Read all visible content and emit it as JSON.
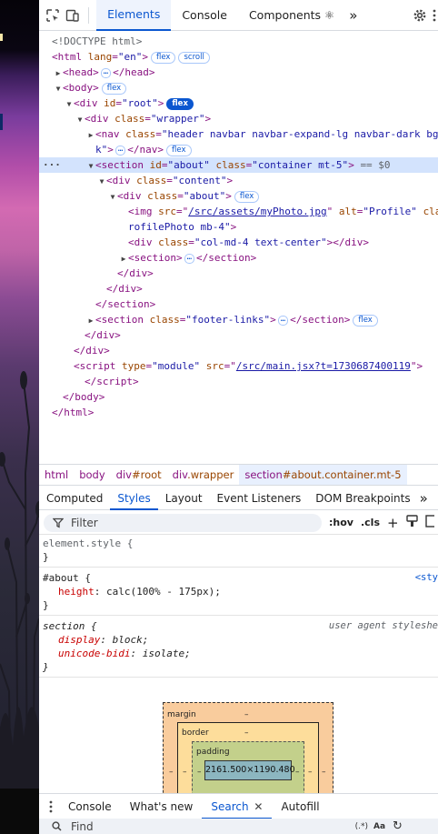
{
  "toolbar": {
    "tabs": [
      "Elements",
      "Console",
      "Components ⚛"
    ],
    "active": "Elements",
    "more": "»"
  },
  "dom": {
    "doctype": "<!DOCTYPE html>",
    "html_tag": "html",
    "html_attr": "lang",
    "html_val": "\"en\"",
    "badge_flex": "flex",
    "badge_scroll": "scroll",
    "head": "head",
    "body": "body",
    "div": "div",
    "id_attr": "id",
    "root_val": "\"root\"",
    "class_attr": "class",
    "wrapper_val": "\"wrapper\"",
    "nav": "nav",
    "nav_class_1": "\"header navbar navbar-expand-lg navbar-dark bg",
    "nav_class_2": "k\"",
    "section": "section",
    "about_id": "\"about\"",
    "section_class": "\"container mt-5\"",
    "eq_var": "== $0",
    "content_val": "\"content\"",
    "about_val": "\"about\"",
    "img": "img",
    "src_attr": "src",
    "img_src": "/src/assets/myPhoto.jpg",
    "alt_attr": "alt",
    "alt_val": "\"Profile\"",
    "img_cont": "cla",
    "img_class_2": "rofilePhoto mb-4\"",
    "col_val": "\"col-md-4 text-center\"",
    "footer_val": "\"footer-links\"",
    "script": "script",
    "type_attr": "type",
    "module_val": "\"module\"",
    "script_src": "/src/main.jsx?t=1730687400119"
  },
  "breadcrumbs": [
    {
      "tag": "html",
      "cls": ""
    },
    {
      "tag": "body",
      "cls": ""
    },
    {
      "tag": "div",
      "cls": "#root"
    },
    {
      "tag": "div",
      "cls": ".wrapper"
    },
    {
      "tag": "section",
      "cls": "#about.container.mt-5"
    }
  ],
  "styles_tabs": [
    "Computed",
    "Styles",
    "Layout",
    "Event Listeners",
    "DOM Breakpoints"
  ],
  "styles_active": "Styles",
  "filter": {
    "placeholder": "Filter",
    "hov": ":hov",
    "cls": ".cls",
    "plus": "+"
  },
  "rules": {
    "element_style": "element.style {",
    "close": "}",
    "about_sel": "#about {",
    "about_src": "<sty",
    "height_prop": "height",
    "height_val": "calc(100% - 175px);",
    "section_sel": "section {",
    "ua_src": "user agent styleshe",
    "display_prop": "display",
    "display_val": "block;",
    "bidi_prop": "unicode-bidi",
    "bidi_val": "isolate;"
  },
  "box_model": {
    "margin": "margin",
    "border": "border",
    "padding": "padding",
    "dash": "–",
    "content": "2161.500×1190.480"
  },
  "drawer": {
    "tabs": [
      "Console",
      "What's new",
      "Search",
      "Autofill"
    ],
    "active": "Search",
    "find_placeholder": "Find",
    "regex": "(.*)",
    "case": "Aa"
  }
}
